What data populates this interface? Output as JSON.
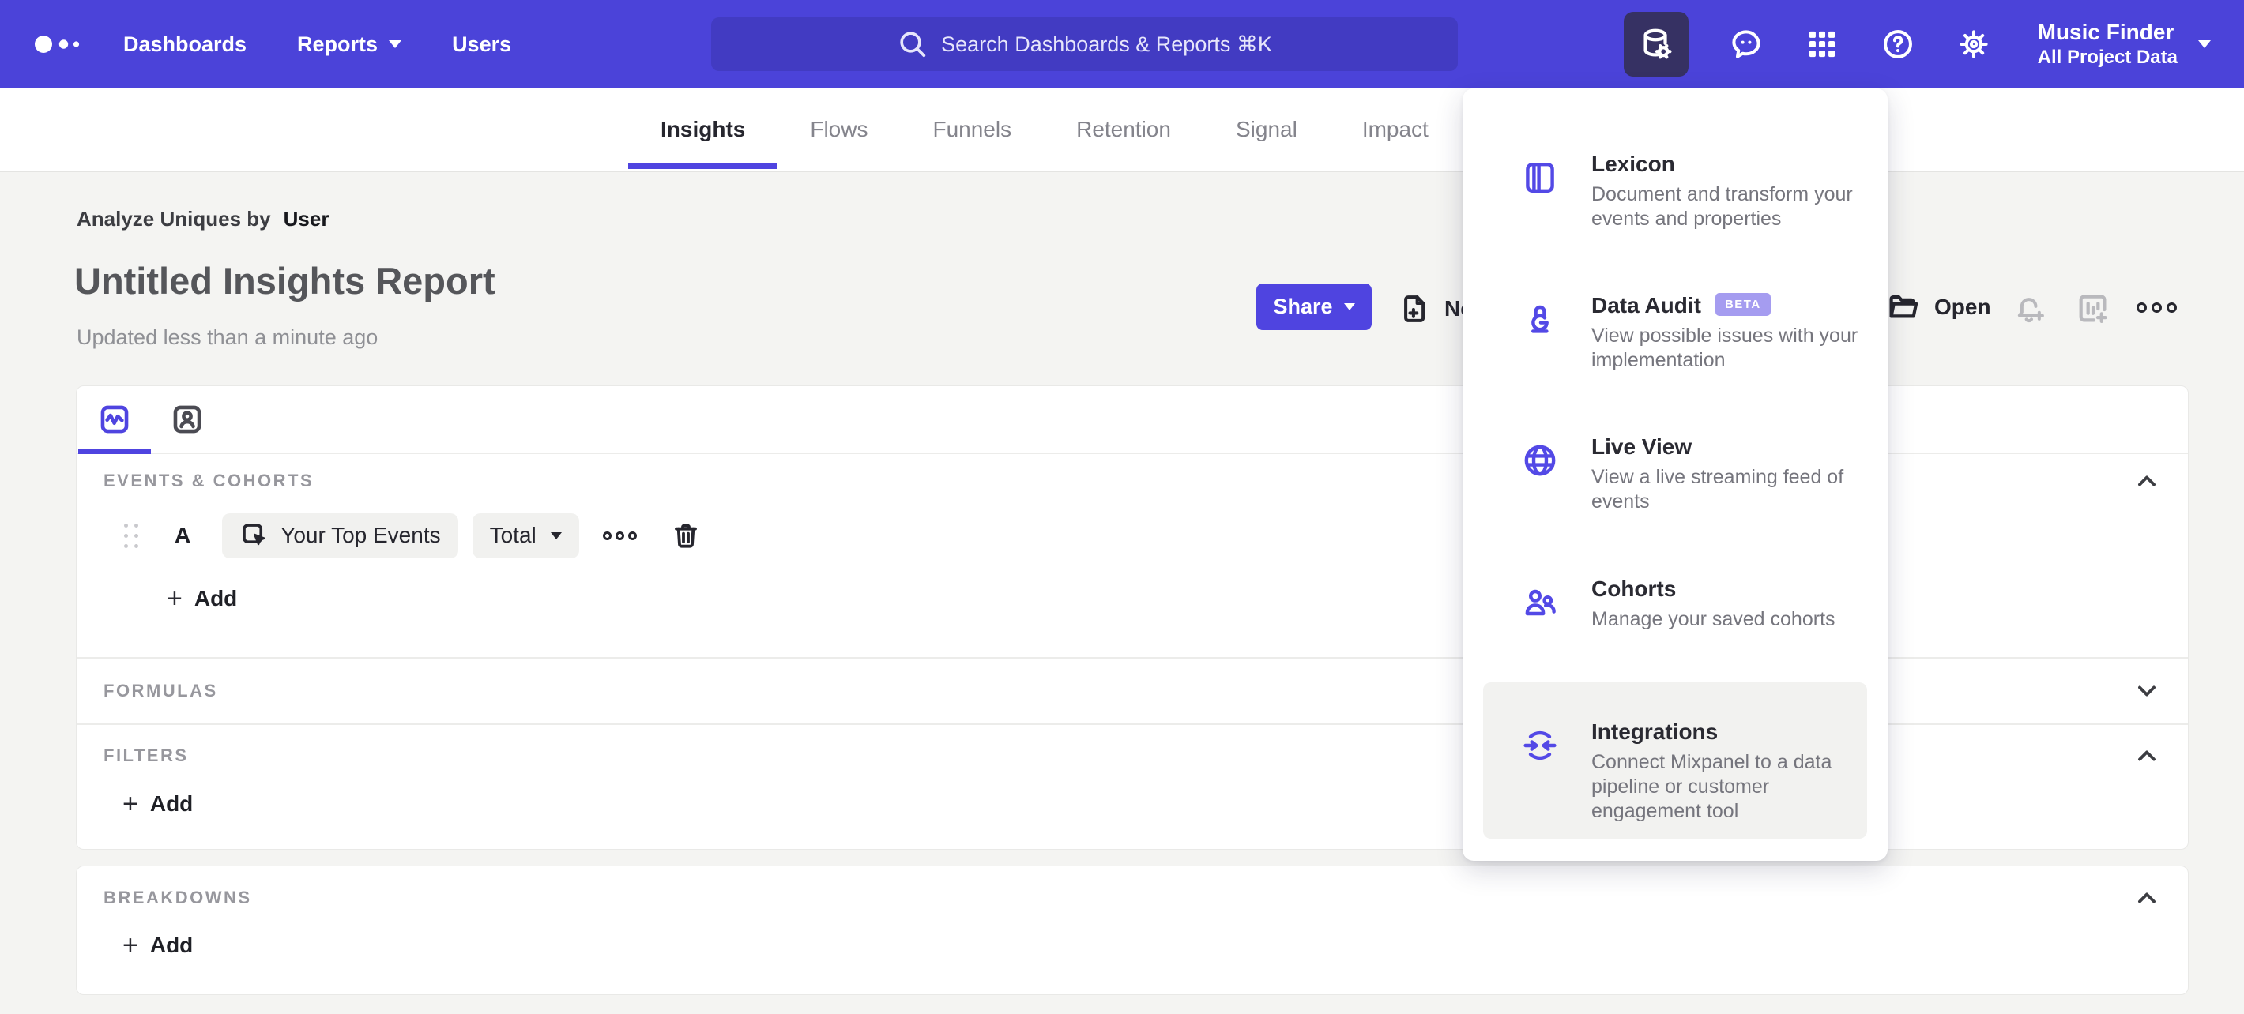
{
  "nav": {
    "items": [
      {
        "label": "Dashboards"
      },
      {
        "label": "Reports"
      },
      {
        "label": "Users"
      }
    ],
    "search": {
      "placeholder": "Search Dashboards & Reports ⌘K"
    },
    "project": {
      "name": "Music Finder",
      "scope": "All Project Data"
    }
  },
  "tabs": {
    "active": "Insights",
    "items": [
      {
        "label": "Insights"
      },
      {
        "label": "Flows"
      },
      {
        "label": "Funnels"
      },
      {
        "label": "Retention"
      },
      {
        "label": "Signal"
      },
      {
        "label": "Impact"
      }
    ]
  },
  "report": {
    "eyebrow_prefix": "Analyze Uniques by",
    "eyebrow_value": "User",
    "title": "Untitled Insights Report",
    "updated": "Updated less than a minute ago"
  },
  "actions": {
    "share": "Share",
    "new": "New",
    "open": "Open"
  },
  "builder": {
    "sections": {
      "events": "EVENTS & COHORTS",
      "formulas": "FORMULAS",
      "filters": "FILTERS",
      "breakdowns": "BREAKDOWNS"
    },
    "series": {
      "letter": "A",
      "event": "Your Top Events",
      "metric": "Total"
    },
    "add": {
      "plus": "+",
      "label": "Add"
    }
  },
  "menu": {
    "items": [
      {
        "title": "Lexicon",
        "desc": "Document and transform your events and properties"
      },
      {
        "title": "Data Audit",
        "badge": "BETA",
        "desc": "View possible issues with your implementation"
      },
      {
        "title": "Live View",
        "desc": "View a live streaming feed of events"
      },
      {
        "title": "Cohorts",
        "desc": "Manage your saved cohorts"
      },
      {
        "title": "Integrations",
        "desc": "Connect Mixpanel to a data pipeline or customer engagement tool",
        "highlighted": true
      }
    ]
  },
  "colors": {
    "nav": "#4b43d9",
    "accent": "#4f44e0",
    "active_tile": "#363163",
    "badge": "#a59cf0"
  }
}
